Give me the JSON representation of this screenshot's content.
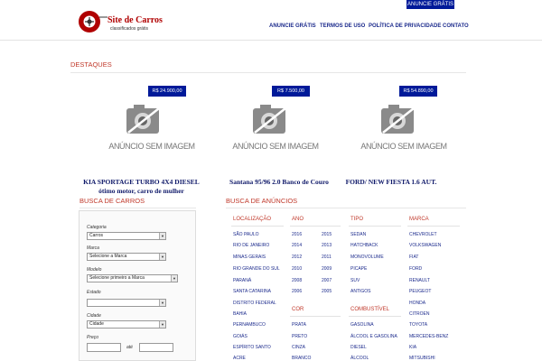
{
  "header": {
    "top_button": "ANUNCIE GRÁTIS",
    "logo_title": "Site de Carros",
    "logo_subtitle": "classificados grátis",
    "nav": [
      "ANUNCIE GRÁTIS",
      "TERMOS DE USO",
      "POLÍTICA DE PRIVACIDADE",
      "CONTATO"
    ]
  },
  "destaques": {
    "title": "DESTAQUES",
    "no_image_text": "ANÚNCIO SEM IMAGEM",
    "cars": [
      {
        "price": "R$ 24.900,00",
        "title": "KIA SPORTAGE TURBO 4X4 DIESEL ótimo motor, carro de mulher"
      },
      {
        "price": "R$ 7.500,00",
        "title": "Santana 95/96 2.0 Banco de Couro"
      },
      {
        "price": "R$ 54.890,00",
        "title": "FORD/ NEW FIESTA 1.6 AUT."
      }
    ]
  },
  "search_panel": {
    "title": "BUSCA DE CARROS",
    "categoria_label": "Categoria",
    "categoria_value": "Carros",
    "marca_label": "Marca",
    "marca_value": "Selecione a Marca",
    "modelo_label": "Modelo",
    "modelo_value": "Selecione primeiro a Marca",
    "estado_label": "Estado",
    "estado_value": "",
    "cidade_label": "Cidade",
    "cidade_value": "Cidade",
    "preco_label": "Preço",
    "preco_ate": "até"
  },
  "busca_anuncios": {
    "title": "BUSCA DE ANÚNCIOS",
    "localizacao": {
      "title": "LOCALIZAÇÃO",
      "items": [
        "SÃO PAULO",
        "RIO DE JANEIRO",
        "MINAS GERAIS",
        "RIO GRANDE DO SUL",
        "PARANÁ",
        "SANTA CATARINA",
        "DISTRITO FEDERAL",
        "BAHIA",
        "PERNAMBUCO",
        "GOIÁS",
        "ESPÍRITO SANTO",
        "ACRE"
      ]
    },
    "ano": {
      "title": "ANO",
      "col1": [
        "2016",
        "2014",
        "2012",
        "2010",
        "2008",
        "2006"
      ],
      "col2": [
        "2015",
        "2013",
        "2011",
        "2009",
        "2007",
        "2005"
      ]
    },
    "cor": {
      "title": "COR",
      "items": [
        "PRATA",
        "PRETO",
        "CINZA",
        "BRANCO"
      ]
    },
    "tipo": {
      "title": "TIPO",
      "items": [
        "SEDAN",
        "HATCHBACK",
        "MONOVOLUME",
        "PICAPE",
        "SUV",
        "ANTIGOS"
      ]
    },
    "combustivel": {
      "title": "COMBUSTÍVEL",
      "items": [
        "GASOLINA",
        "ÁLCOOL E GASOLINA",
        "DIESEL",
        "ÁLCOOL"
      ]
    },
    "marca": {
      "title": "MARCA",
      "items": [
        "CHEVROLET",
        "VOLKSWAGEN",
        "FIAT",
        "FORD",
        "RENAULT",
        "PEUGEOT",
        "HONDA",
        "CITROEN",
        "TOYOTA",
        "MERCEDES-BENZ",
        "KIA",
        "MITSUBISHI"
      ]
    }
  }
}
